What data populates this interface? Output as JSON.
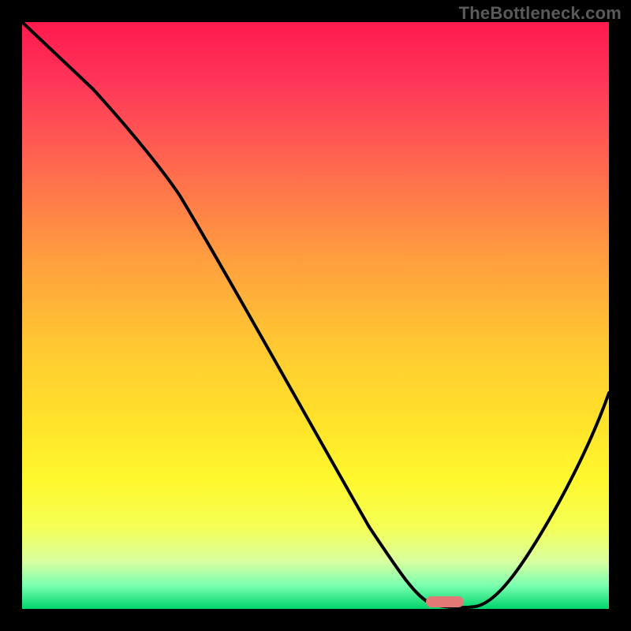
{
  "watermark": "TheBottleneck.com",
  "chart_data": {
    "type": "line",
    "title": "",
    "xlabel": "",
    "ylabel": "",
    "xlim": [
      0,
      100
    ],
    "ylim": [
      0,
      100
    ],
    "grid": false,
    "annotations": [
      {
        "name": "optimal-marker",
        "x_percent": 72,
        "color": "#e17a77"
      }
    ],
    "series": [
      {
        "name": "bottleneck-curve",
        "x": [
          0,
          10,
          18,
          28,
          40,
          52,
          63,
          68,
          72,
          76,
          80,
          88,
          100
        ],
        "values": [
          100,
          90,
          81,
          70,
          54,
          38,
          18,
          6,
          1,
          0,
          4,
          18,
          44
        ]
      }
    ],
    "background_gradient": {
      "top": "#ff1a4d",
      "middle": "#ffe22a",
      "bottom": "#00d46b"
    }
  }
}
